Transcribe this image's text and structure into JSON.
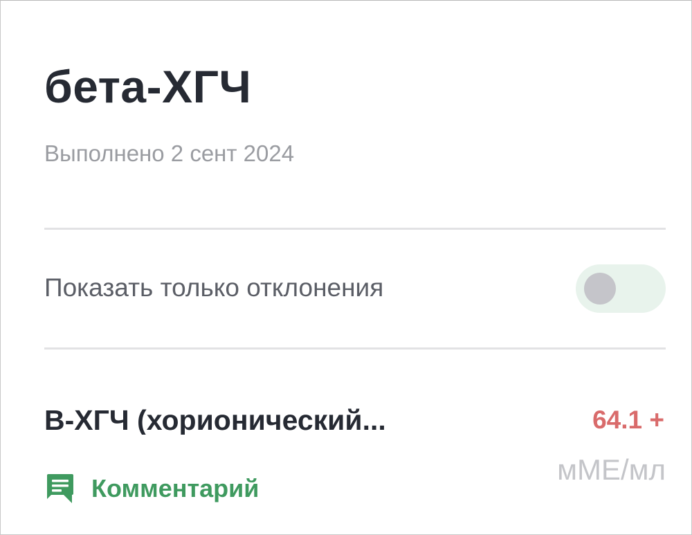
{
  "header": {
    "title": "бета-ХГЧ",
    "subtitle": "Выполнено 2 сент 2024"
  },
  "filter": {
    "label": "Показать только отклонения",
    "enabled": false
  },
  "result": {
    "name": "B-ХГЧ (хорионический...",
    "value": "64.1 +",
    "unit": "мМЕ/мл",
    "comment_label": "Комментарий",
    "comment_icon": "comment-icon"
  },
  "colors": {
    "title": "#262a33",
    "abnormal_value": "#d96b6b",
    "accent_green": "#3f9a5f",
    "toggle_track": "#e8f3ec",
    "toggle_knob": "#c5c5ca",
    "divider": "#e2e2e4"
  }
}
